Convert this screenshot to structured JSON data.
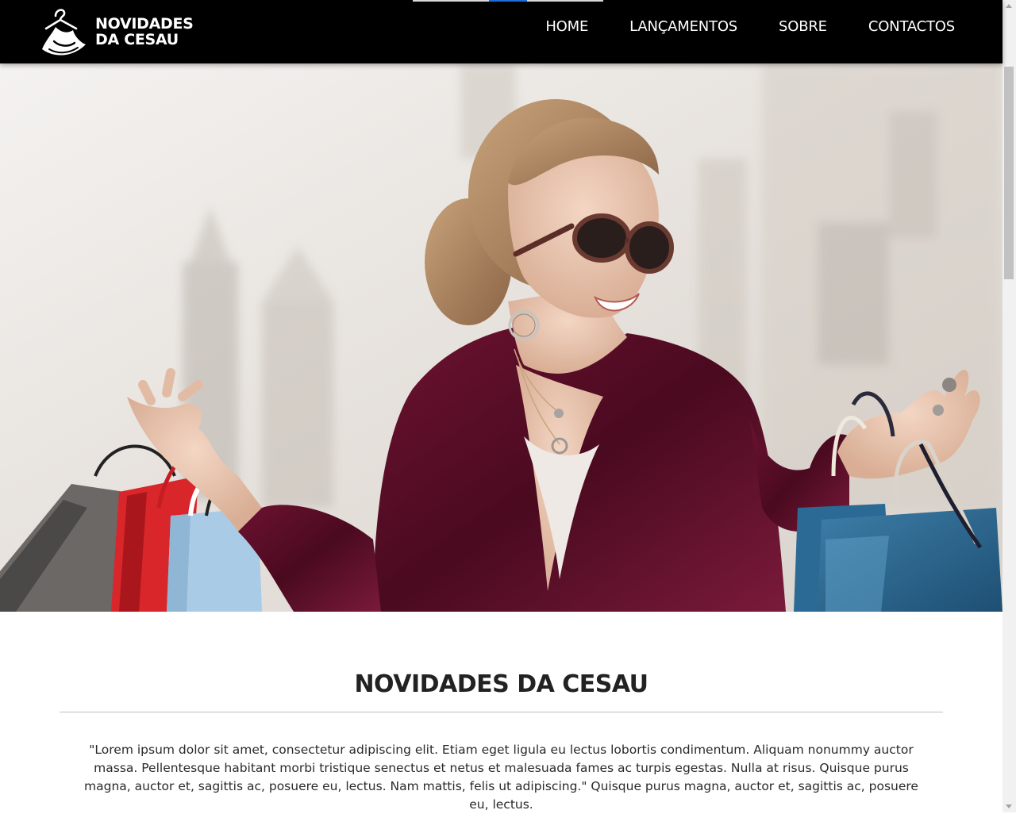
{
  "brand": {
    "line1": "NOVIDADES",
    "line2": "DA CESAU",
    "logo": "hanger-dress-logo-icon"
  },
  "nav": {
    "items": [
      {
        "label": "HOME"
      },
      {
        "label": "LANÇAMENTOS"
      },
      {
        "label": "SOBRE"
      },
      {
        "label": "CONTACTOS"
      }
    ]
  },
  "hero": {
    "image": "woman-with-shopping-bags-photo"
  },
  "section": {
    "title": "NOVIDADES DA CESAU",
    "paragraph": "\"Lorem ipsum dolor sit amet, consectetur adipiscing elit. Etiam eget ligula eu lectus lobortis condimentum. Aliquam nonummy auctor massa. Pellentesque habitant morbi tristique senectus et netus et malesuada fames ac turpis egestas. Nulla at risus. Quisque purus magna, auctor et, sagittis ac, posuere eu, lectus. Nam mattis, felis ut adipiscing.\" Quisque purus magna, auctor et, sagittis ac, posuere eu, lectus."
  },
  "colors": {
    "header_bg": "#000000",
    "header_text": "#ffffff",
    "title_text": "#222222",
    "accent_blue": "#1e6fd9"
  }
}
